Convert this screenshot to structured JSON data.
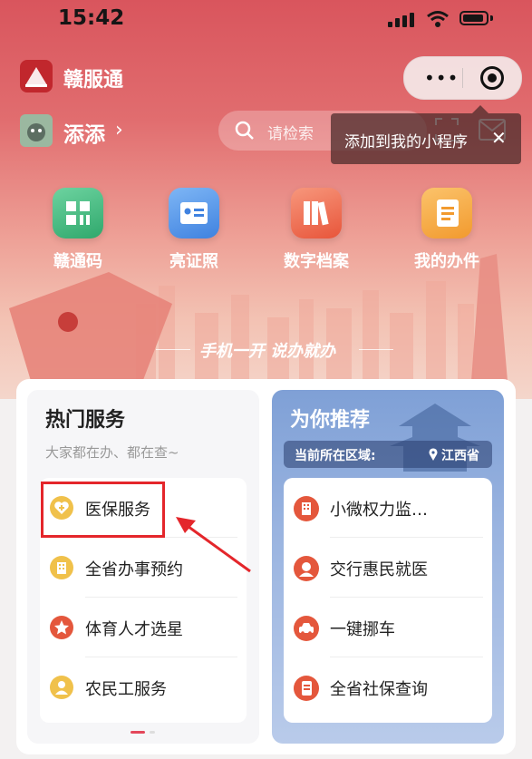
{
  "status_bar": {
    "time": "15:42"
  },
  "header": {
    "app_name": "赣服通"
  },
  "user": {
    "name": "添添",
    "chevron": "›"
  },
  "search": {
    "placeholder": "请检索"
  },
  "tooltip": {
    "text": "添加到我的小程序",
    "close": "✕"
  },
  "capsule": {
    "more": "•••"
  },
  "quick_actions": [
    {
      "label": "赣通码",
      "icon": "qr-grid-icon",
      "color": "#3fb37c"
    },
    {
      "label": "亮证照",
      "icon": "id-card-icon",
      "color": "#4a8fe7"
    },
    {
      "label": "数字档案",
      "icon": "archive-books-icon",
      "color": "#ef6a4b"
    },
    {
      "label": "我的办件",
      "icon": "document-icon",
      "color": "#f4a23a"
    }
  ],
  "banner": {
    "slogan": "手机一开 说办就办"
  },
  "hot_services": {
    "title": "热门服务",
    "subtitle": "大家都在办、都在查~",
    "items": [
      {
        "label": "医保服务",
        "icon": "medical-insurance-icon",
        "color": "#e9b23a"
      },
      {
        "label": "全省办事预约",
        "icon": "building-icon",
        "color": "#e9b23a"
      },
      {
        "label": "体育人才选星",
        "icon": "star-icon",
        "color": "#e4573c"
      },
      {
        "label": "农民工服务",
        "icon": "worker-icon",
        "color": "#e9b23a"
      }
    ]
  },
  "recommend": {
    "title": "为你推荐",
    "region_label": "当前所在区域:",
    "region_value": "江西省",
    "items": [
      {
        "label": "小微权力监…",
        "icon": "building-icon"
      },
      {
        "label": "交行惠民就医",
        "icon": "doctor-icon"
      },
      {
        "label": "一键挪车",
        "icon": "car-icon"
      },
      {
        "label": "全省社保查询",
        "icon": "document-icon"
      }
    ]
  }
}
